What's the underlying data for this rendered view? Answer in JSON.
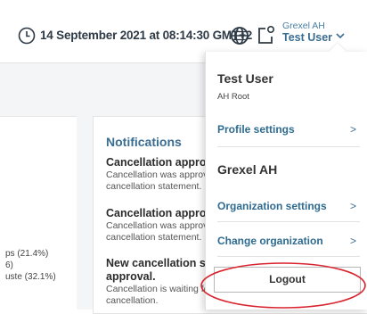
{
  "header": {
    "datetime": "14 September 2021 at 08:14:30 GMT+2",
    "org_label": "Grexel AH",
    "user_label": "Test User",
    "icons": [
      "clock-icon",
      "globe-icon",
      "switch-organization-icon",
      "chevron-down-icon"
    ]
  },
  "background": {
    "legend": [
      "ps (21.4%)",
      "6)",
      "uste (32.1%)"
    ],
    "notifications": {
      "title": "Notifications",
      "items": [
        {
          "title": "Cancellation approve",
          "text1": "Cancellation was approve",
          "text2": "cancellation statement."
        },
        {
          "title": "Cancellation approve",
          "text1": "Cancellation was approve",
          "text2": "cancellation statement."
        },
        {
          "title1": "New cancellation ser",
          "title2": "approval.",
          "text1": "Cancellation is waiting for",
          "text2": "cancellation."
        }
      ]
    }
  },
  "dropdown": {
    "user_name": "Test User",
    "user_role": "AH Root",
    "profile_settings": "Profile settings",
    "org_name": "Grexel AH",
    "organization_settings": "Organization settings",
    "change_organization": "Change organization",
    "arrow": ">",
    "logout": "Logout"
  },
  "colors": {
    "accent_text": "#3a6d92",
    "annotation": "#d9232e"
  }
}
